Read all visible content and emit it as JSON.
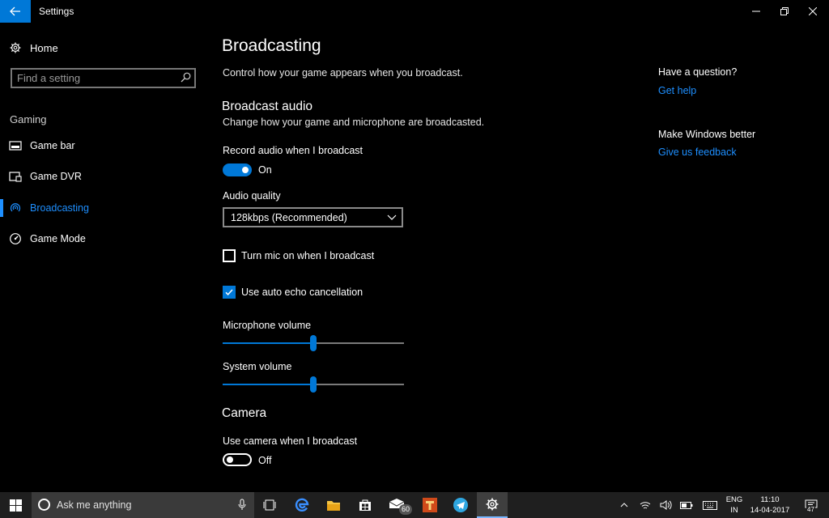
{
  "window": {
    "title": "Settings"
  },
  "sidebar": {
    "home_label": "Home",
    "search_placeholder": "Find a setting",
    "section_label": "Gaming",
    "items": [
      {
        "label": "Game bar",
        "icon": "game-bar-icon"
      },
      {
        "label": "Game DVR",
        "icon": "game-dvr-icon"
      },
      {
        "label": "Broadcasting",
        "icon": "broadcasting-icon",
        "active": true
      },
      {
        "label": "Game Mode",
        "icon": "game-mode-icon"
      }
    ]
  },
  "main": {
    "title": "Broadcasting",
    "description": "Control how your game appears when you broadcast.",
    "audio": {
      "heading": "Broadcast audio",
      "description": "Change how your game and microphone are broadcasted.",
      "record_label": "Record audio when I broadcast",
      "record_state": "On",
      "quality_label": "Audio quality",
      "quality_value": "128kbps (Recommended)",
      "mic_checkbox_label": "Turn mic on when I broadcast",
      "mic_checked": false,
      "echo_checkbox_label": "Use auto echo cancellation",
      "echo_checked": true,
      "mic_volume_label": "Microphone volume",
      "mic_volume": 50,
      "system_volume_label": "System volume",
      "system_volume": 50
    },
    "camera": {
      "heading": "Camera",
      "use_label": "Use camera when I broadcast",
      "use_state": "Off"
    }
  },
  "help": {
    "question_heading": "Have a question?",
    "get_help_link": "Get help",
    "better_heading": "Make Windows better",
    "feedback_link": "Give us feedback"
  },
  "taskbar": {
    "search_text": "Ask me anything",
    "mail_badge": "60",
    "language_top": "ENG",
    "language_bottom": "IN",
    "time": "11:10",
    "date": "14-04-2017",
    "notification_count": "47"
  },
  "colors": {
    "accent": "#0078d7",
    "link": "#1e8fff",
    "background": "#000000",
    "taskbar": "#1f1f1f"
  }
}
